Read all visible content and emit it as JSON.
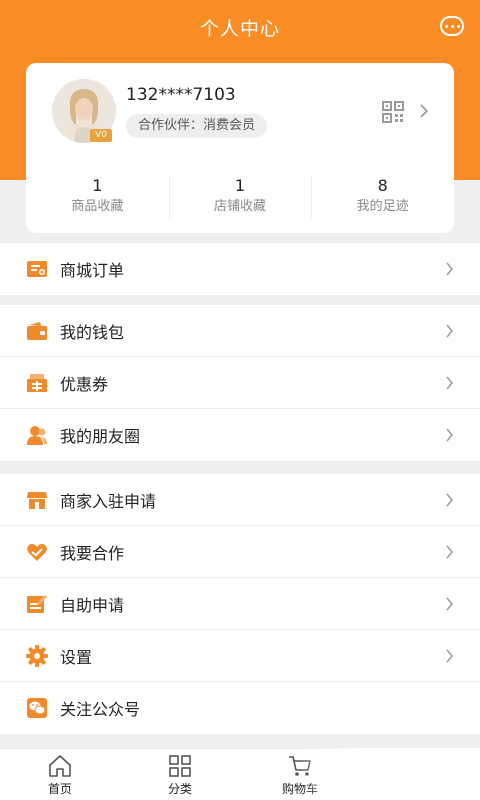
{
  "header": {
    "title": "个人中心",
    "more_icon": "more-dots-icon"
  },
  "colors": {
    "accent": "#fa8c26",
    "icon": "#f08a2a",
    "background": "#efeff1"
  },
  "profile": {
    "phone": "132****7103",
    "member_tag": "合作伙伴：消费会员",
    "vip_badge": "V0",
    "stats": [
      {
        "count": "1",
        "label": "商品收藏"
      },
      {
        "count": "1",
        "label": "店铺收藏"
      },
      {
        "count": "8",
        "label": "我的足迹"
      }
    ]
  },
  "menu_groups": [
    [
      {
        "label": "商城订单",
        "icon": "order-list-icon",
        "arrow": true
      }
    ],
    [
      {
        "label": "我的钱包",
        "icon": "wallet-icon",
        "arrow": true
      },
      {
        "label": "优惠券",
        "icon": "coupon-icon",
        "arrow": true
      },
      {
        "label": "我的朋友圈",
        "icon": "friends-icon",
        "arrow": true
      }
    ],
    [
      {
        "label": "商家入驻申请",
        "icon": "store-icon",
        "arrow": true
      },
      {
        "label": "我要合作",
        "icon": "handshake-icon",
        "arrow": true
      },
      {
        "label": "自助申请",
        "icon": "form-edit-icon",
        "arrow": true
      },
      {
        "label": "设置",
        "icon": "gear-icon",
        "arrow": true
      },
      {
        "label": "关注公众号",
        "icon": "wechat-icon",
        "arrow": false
      }
    ]
  ],
  "tabbar": [
    {
      "label": "首页",
      "icon": "home-icon"
    },
    {
      "label": "分类",
      "icon": "grid-icon"
    },
    {
      "label": "购物车",
      "icon": "cart-icon"
    }
  ]
}
